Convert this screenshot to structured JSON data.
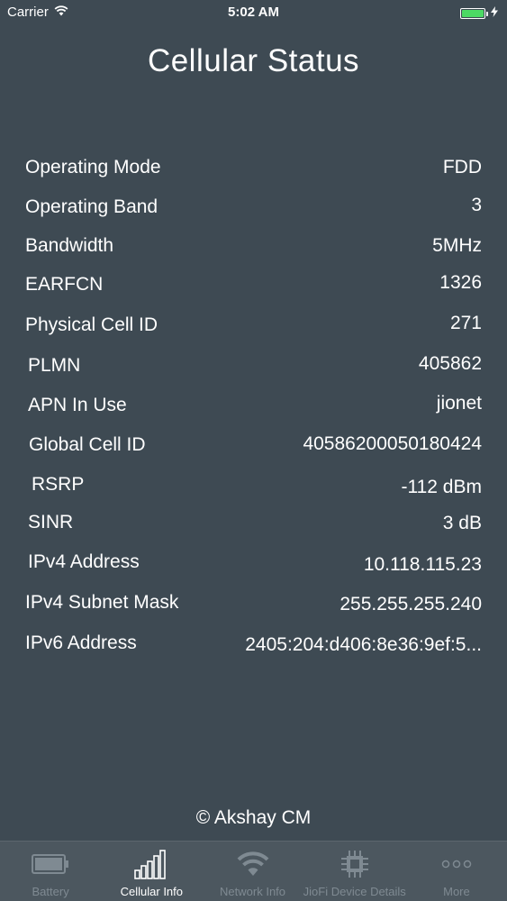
{
  "status_bar": {
    "carrier": "Carrier",
    "time": "5:02 AM",
    "icons": [
      "wifi-icon",
      "battery-icon",
      "charging-icon"
    ]
  },
  "page": {
    "title": "Cellular Status",
    "footer": "© Akshay CM"
  },
  "rows": [
    {
      "label": "Operating Mode",
      "value": "FDD"
    },
    {
      "label": "Operating Band",
      "value": "3"
    },
    {
      "label": "Bandwidth",
      "value": "5MHz"
    },
    {
      "label": "EARFCN",
      "value": "1326"
    },
    {
      "label": "Physical Cell ID",
      "value": "271"
    },
    {
      "label": "PLMN",
      "value": "405862"
    },
    {
      "label": "APN In Use",
      "value": "jionet"
    },
    {
      "label": "Global Cell ID",
      "value": "40586200050180424"
    },
    {
      "label": "RSRP",
      "value": "-112 dBm"
    },
    {
      "label": "SINR",
      "value": "3 dB"
    },
    {
      "label": "IPv4 Address",
      "value": "10.118.115.23"
    },
    {
      "label": "IPv4 Subnet Mask",
      "value": "255.255.255.240"
    },
    {
      "label": "IPv6 Address",
      "value": "2405:204:d406:8e36:9ef:5..."
    }
  ],
  "tab_bar": {
    "active": "Cellular Info",
    "tabs": [
      {
        "label": "Battery",
        "icon": "battery-tab-icon"
      },
      {
        "label": "Cellular Info",
        "icon": "signal-bars-icon"
      },
      {
        "label": "Network Info",
        "icon": "wifi-tab-icon"
      },
      {
        "label": "JioFi Device Details",
        "icon": "chip-icon"
      },
      {
        "label": "More",
        "icon": "more-dots-icon"
      }
    ]
  },
  "colors": {
    "background": "#3e4a53",
    "tab_bar": "#4c575f",
    "tab_inactive": "#7f8a92",
    "battery_fill": "#4cd964"
  }
}
